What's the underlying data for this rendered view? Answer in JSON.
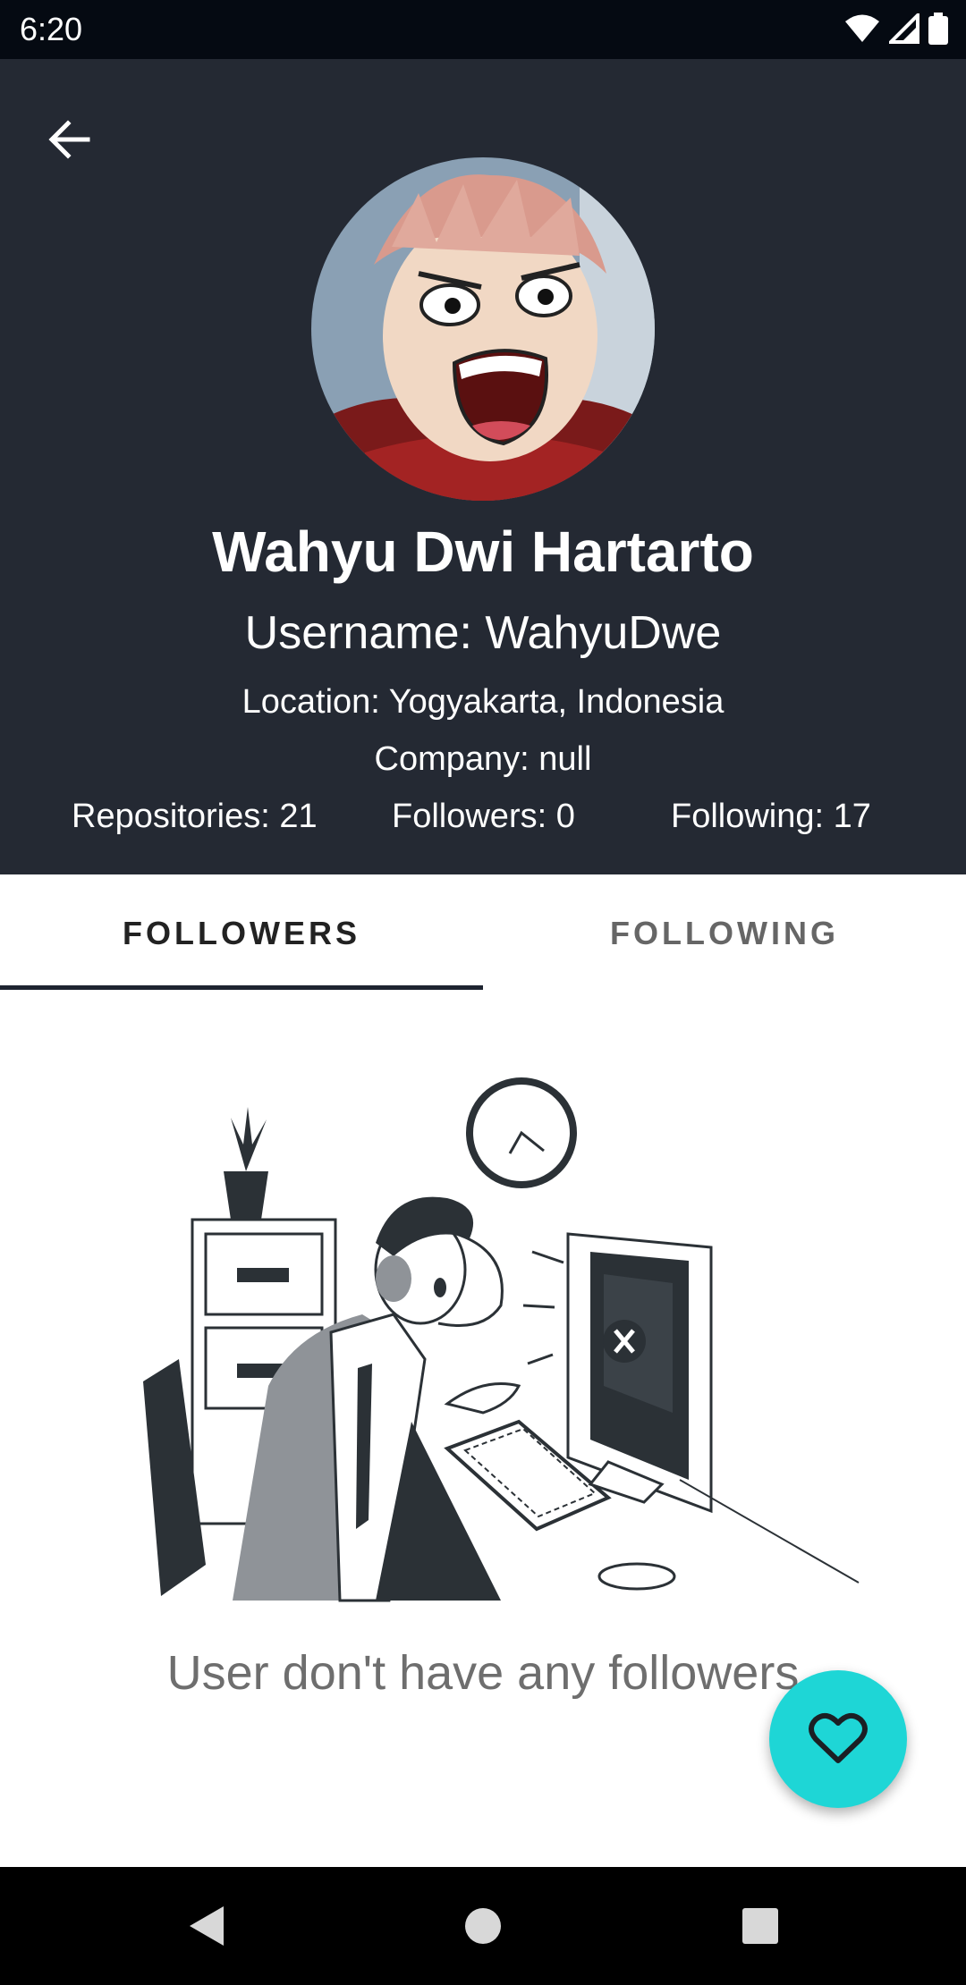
{
  "status_bar": {
    "time": "6:20"
  },
  "profile": {
    "name": "Wahyu Dwi Hartarto",
    "username": "Username: WahyuDwe",
    "location": "Location: Yogyakarta, Indonesia",
    "company": "Company: null",
    "repositories": "Repositories: 21",
    "followers": "Followers: 0",
    "following": "Following: 17"
  },
  "tabs": [
    {
      "label": "FOLLOWERS",
      "selected": true
    },
    {
      "label": "FOLLOWING",
      "selected": false
    }
  ],
  "empty_state": {
    "message": "User don't have any followers"
  },
  "colors": {
    "header_bg": "#242933",
    "fab": "#1ed6d6",
    "tab_indicator": "#1e2430"
  },
  "icons": {
    "back": "arrow-left-icon",
    "fab": "heart-outline-icon",
    "nav": [
      "back-triangle-icon",
      "home-circle-icon",
      "recents-square-icon"
    ]
  }
}
